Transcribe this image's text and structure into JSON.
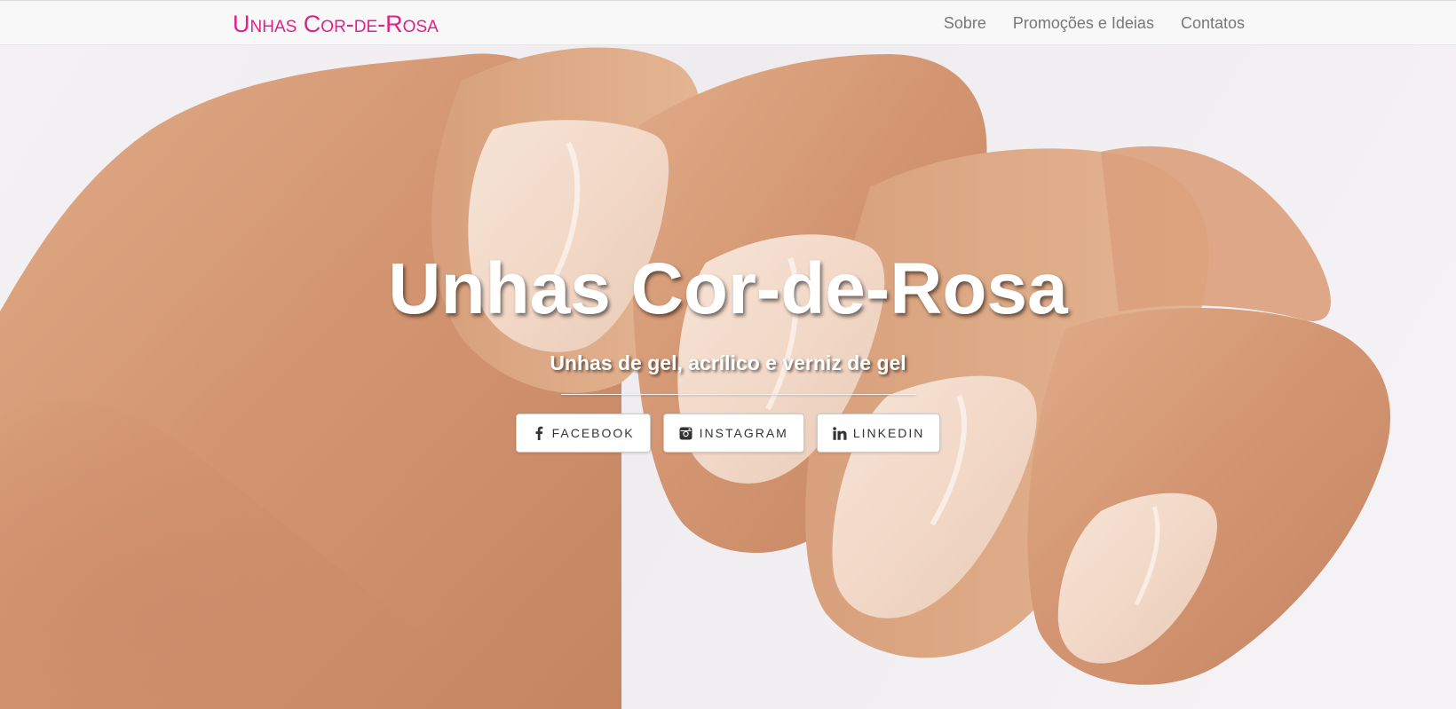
{
  "navbar": {
    "brand": "Unhas Cor-de-Rosa",
    "links": [
      {
        "label": "Sobre"
      },
      {
        "label": "Promoções e Ideias"
      },
      {
        "label": "Contatos"
      }
    ]
  },
  "intro": {
    "title": "Unhas Cor-de-Rosa",
    "subtitle": "Unhas de gel, acrílico e verniz de gel",
    "social": [
      {
        "label": "Facebook",
        "icon": "facebook-icon"
      },
      {
        "label": "Instagram",
        "icon": "instagram-icon"
      },
      {
        "label": "LinkedIn",
        "icon": "linkedin-icon"
      }
    ]
  },
  "colors": {
    "brand": "#e0218a",
    "nav_text": "#777777",
    "navbar_bg": "#f8f8f8",
    "button_bg": "#ffffff",
    "button_text": "#333333"
  }
}
